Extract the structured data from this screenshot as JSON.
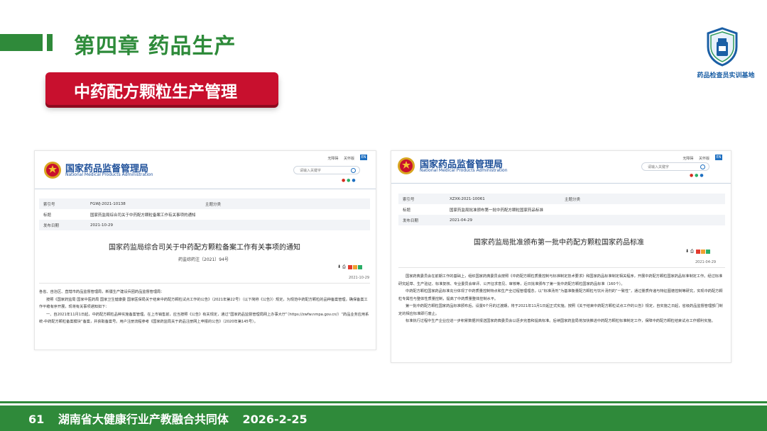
{
  "header": {
    "chapter_title": "第四章  药品生产",
    "section_title": "中药配方颗粒生产管理",
    "logo_label": "药品检查员实训基地",
    "logo_icon": "shield-bottle-icon",
    "brand_green": "#2f8a3a",
    "brand_red": "#c8102e"
  },
  "site": {
    "name_cn": "国家药品监督管理局",
    "name_en": "National Medical Products Administration",
    "top_links": [
      "无障碍",
      "关怀版"
    ],
    "en_label": "EN",
    "search_placeholder": "请输入关键字",
    "emblem_icon": "national-emblem-icon"
  },
  "doc1": {
    "meta": [
      {
        "key": "索引号",
        "value": "FGWJ-2021-10138",
        "key2": "主题分类",
        "value2": ""
      },
      {
        "key": "标题",
        "value": "国家药监局综合司关于中药配方颗粒备案工作有关事项的通知",
        "key2": "",
        "value2": ""
      },
      {
        "key": "发布日期",
        "value": "2021-10-29",
        "key2": "",
        "value2": ""
      }
    ],
    "title": "国家药监局综合司关于中药配方颗粒备案工作有关事项的通知",
    "doc_number": "药监综药注〔2021〕94号",
    "date_right": "2021-10-29",
    "paragraphs": [
      "各省、自治区、直辖市药品监督管理局，新疆生产建设兵团药品监督管理局：",
      "按照《国家药监局 国家中医药局 国家卫生健康委 国家医保局关于结束中药配方颗粒试点工作的公告》（2021年第22号）（以下简称《公告》）规定，为规范中药配方颗粒的品种备案管理，确保备案工作平稳有序开展，现将有关事项通知如下：",
      "一、自2021年11月1日起，中药配方颗粒品种实施备案管理。在上市销售前，应当按照《公告》有关规定，通过“国家药品监督管理局网上办事大厅”（https://zwfw.nmpa.gov.cn/）“药品业务应用系统-中药配方颗粒备案模块”备案，并获取备案号。用户注册流程参考《国家药监局关于药品注册网上申报的公告》（2020年第145号）。"
    ]
  },
  "doc2": {
    "meta": [
      {
        "key": "索引号",
        "value": "XZXK-2021-10061",
        "key2": "主题分类",
        "value2": ""
      },
      {
        "key": "标题",
        "value": "国家药监局批准颁布第一批中药配方颗粒国家药品标准",
        "key2": "",
        "value2": ""
      },
      {
        "key": "发布日期",
        "value": "2021-04-29",
        "key2": "",
        "value2": ""
      }
    ],
    "title": "国家药监局批准颁布第一批中药配方颗粒国家药品标准",
    "date_right": "2021-04-29",
    "paragraphs": [
      "国家药典委员会在前期工作的基础上，组织国家药典委员会按照《中药配方颗粒质量控制与标准制定技术要求》和国家药品标准制定相关程序，开展中药配方颗粒国家药品标准制定工作。经过标准研究起草、生产验证、标准复核、专业委员会审评、公开征求意见、审核等，近日批准颁布了第一批中药配方颗粒国家药品标准（160个）。",
      "中药配方颗粒国家药品标准充分体现了中药质量控制特点和生产全过程管理理念，以“标准汤剂”为基准衡量配方颗粒与饮片汤剂的“一致性”，通过量质传递与特征图谱控制等研究，实现中药配方颗粒专属性与整体性质量控制，提高了中药质量整体控制水平。",
      "第一批中药配方颗粒国家药品标准颁布后，设置6个月的过渡期，将于2021年11月1日起正式实施。按照《关于结束中药配方颗粒试点工作的公告》规定，自实施之日起，省级药品监督管理部门制定的相应标准即行废止。",
      "标准执行过程中生产企业应进一步积累数据并报送国家药典委员会以逐步完善和提高标准。后续国家药监局将加快推进中药配方颗粒标准制定工作，保障中药配方颗粒结束试点工作顺利实施。"
    ]
  },
  "footer": {
    "page": "61",
    "org": "湖南省大健康行业产教融合共同体",
    "date": "2026-2-25"
  }
}
